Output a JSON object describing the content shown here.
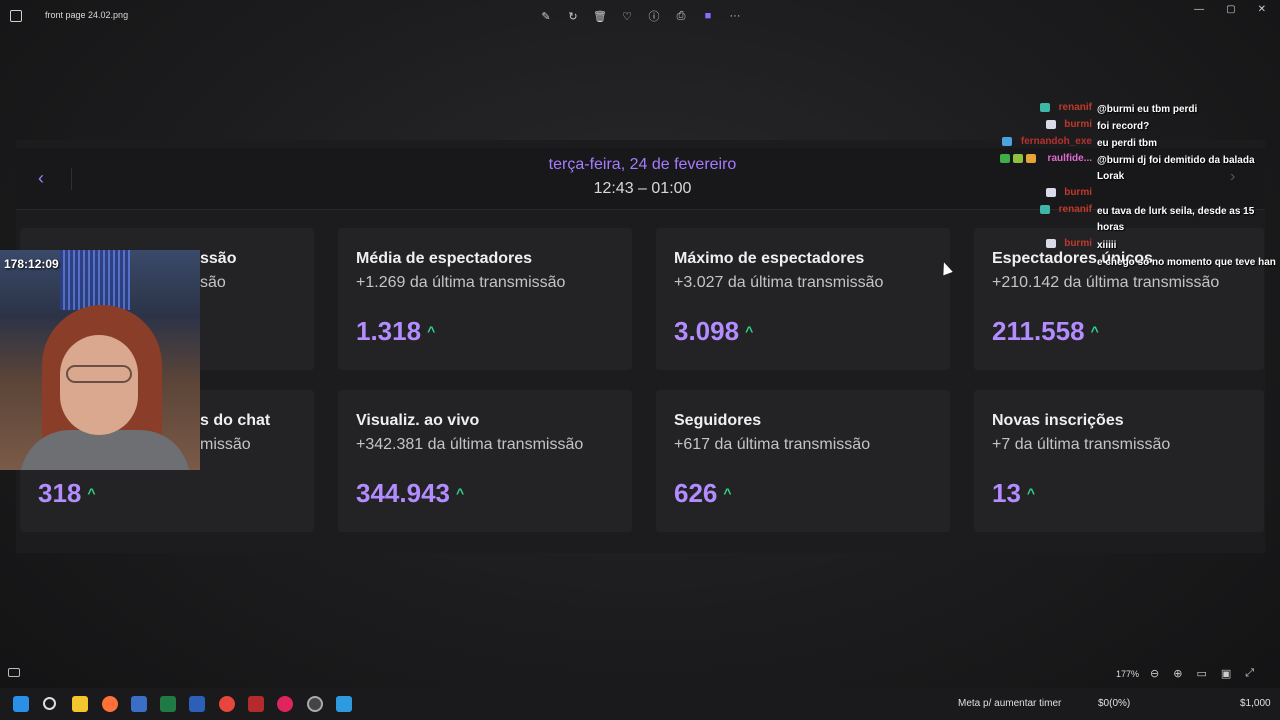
{
  "window": {
    "file_title": "front page 24.02.png"
  },
  "stats": {
    "date": "terça-feira, 24 de fevereiro",
    "time_range": "12:43 – 01:00",
    "cards": [
      {
        "title": "ssão",
        "sub": "são",
        "value": ""
      },
      {
        "title": "Média de espectadores",
        "sub": "+1.269 da última transmissão",
        "value": "1.318"
      },
      {
        "title": "Máximo de espectadores",
        "sub": "+3.027 da última transmissão",
        "value": "3.098"
      },
      {
        "title": "Espectadores únicos",
        "sub": "+210.142 da última transmissão",
        "value": "211.558"
      },
      {
        "title": "s do chat",
        "sub": "missão",
        "value": "318"
      },
      {
        "title": "Visualiz. ao vivo",
        "sub": "+342.381 da última transmissão",
        "value": "344.943"
      },
      {
        "title": "Seguidores",
        "sub": "+617 da última transmissão",
        "value": "626"
      },
      {
        "title": "Novas inscrições",
        "sub": "+7 da última transmissão",
        "value": "13"
      }
    ],
    "arrow": "^",
    "accent_color": "#b38cff",
    "up_color": "#2fd48a"
  },
  "webcam": {
    "timer": "178:12:09"
  },
  "chat": [
    {
      "user": "renanif",
      "msg": "@burmi eu tbm perdi"
    },
    {
      "user": "burmi",
      "msg": "foi record?"
    },
    {
      "user": "fernandoh_exe",
      "msg": "eu perdi tbm"
    },
    {
      "user": "raulfide...",
      "msg": "@burmi dj foi demitido da balada Lorak"
    },
    {
      "user": "burmi",
      "msg": ""
    },
    {
      "user": "renanif",
      "msg": "eu tava de lurk seila, desde as 15 horas"
    },
    {
      "user": "burmi",
      "msg": "xiiiii"
    },
    {
      "user": "",
      "msg": "e chego só no momento que teve han"
    }
  ],
  "viewer": {
    "zoom": "177%"
  },
  "taskbar": {
    "meta_label": "Meta p/ aumentar timer",
    "meta_progress": "$0(0%)",
    "meta_goal": "$1,000"
  }
}
